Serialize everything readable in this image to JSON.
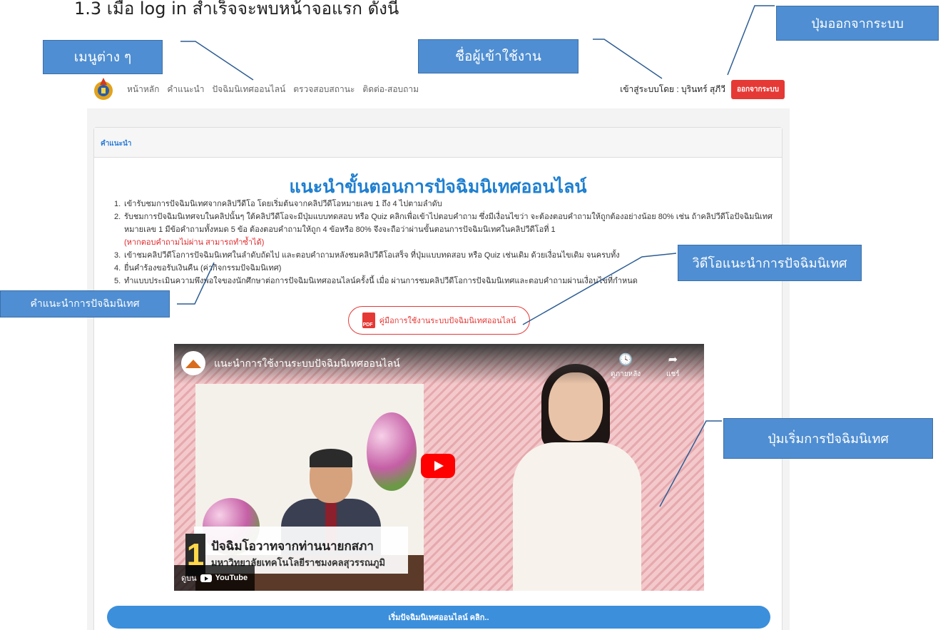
{
  "doc_heading": "1.3 เมื่อ log in สำเร็จจะพบหน้าจอแรก ดังนี้",
  "nav": {
    "menu": [
      "หน้าหลัก",
      "คำแนะนำ",
      "ปัจฉิมนิเทศออนไลน์",
      "ตรวจสอบสถานะ",
      "ติดต่อ-สอบถาม"
    ],
    "login_label": "เข้าสู่ระบบโดย : บุรินทร์ สุภีวี",
    "logout_label": "ออกจากระบบ"
  },
  "card": {
    "header": "คำแนะนำ",
    "title": "แนะนำขั้นตอนการปัจฉิมนิเทศออนไลน์",
    "steps": [
      {
        "num": "1.",
        "text": "เข้ารับชมการปัจฉิมนิเทศจากคลิปวีดีโอ โดยเริ่มต้นจากคลิปวีดีโอหมายเลข 1 ถึง 4 ไปตามลำดับ"
      },
      {
        "num": "2.",
        "text": "รับชมการปัจฉิมนิเทศจบในคลิปนั้นๆ ใต้คลิปวีดีโอจะมีปุ่มแบบทดสอบ หรือ Quiz คลิกเพื่อเข้าไปตอบคำถาม ซึ่งมีเงื่อนไขว่า จะต้องตอบคำถามให้ถูกต้องอย่างน้อย 80% เช่น ถ้าคลิปวีดีโอปัจฉิมนิเทศหมายเลข 1 มีข้อคำถามทั้งหมด 5 ข้อ ต้องตอบคำถามให้ถูก 4 ข้อหรือ 80% จึงจะถือว่าผ่านขั้นตอนการปัจฉิมนิเทศในคลิปวีดีโอที่ 1",
        "note": "(หากตอบคำถามไม่ผ่าน สามารถทำซ้ำได้)"
      },
      {
        "num": "3.",
        "text": "เข้าชมคลิปวีดีโอการปัจฉิมนิเทศในลำดับถัดไป และตอบคำถามหลังชมคลิปวีดีโอเสร็จ ที่ปุ่มแบบทดสอบ หรือ Quiz เช่นเดิม ด้วยเงื่อนไขเดิม จนครบทั้ง"
      },
      {
        "num": "4.",
        "text": "ยื่นคำร้องขอรับเงินคืน (ค่ากิจกรรมปัจฉิมนิเทศ)"
      },
      {
        "num": "5.",
        "text": "ทำแบบประเมินความพึงพอใจของนักศึกษาต่อการปัจฉิมนิเทศออนไลน์ครั้งนี้ เมื่อ ผ่านการชมคลิปวีดีโอการปัจฉิมนิเทศและตอบคำถามผ่านเงื่อนไขที่กำหนด"
      }
    ],
    "manual_label": "คู่มือการใช้งานระบบปัจฉิมนิเทศออนไลน์",
    "start_label": "เริ่มปัจฉิมนิเทศออนไลน์ คลิก.."
  },
  "video": {
    "title": "แนะนำการใช้งานระบบปัจฉิมนิเทศออนไลน์",
    "watch_later": "ดูภายหลัง",
    "share": "แชร์",
    "overlay_number": "1",
    "overlay_line1": "ปัจฉิมโอวาทจากท่านนายกสภา",
    "overlay_line2": "มหาวิทยาลัยเทคโนโลยีราชมงคลสุวรรณภูมิ",
    "watch_on": "ดูบน",
    "youtube": "YouTube"
  },
  "callouts": {
    "menu": "เมนูต่าง ๆ",
    "username": "ชื่อผู้เข้าใช้งาน",
    "logout": "ปุ่มออกจากระบบ",
    "video": "วิดีโอแนะนำการปัจฉิมนิเทศ",
    "instructions": "คำแนะนำการปัจฉิมนิเทศ",
    "start": "ปุ่มเริ่มการปัจฉิมนิเทศ"
  },
  "colors": {
    "accent": "#1e7fd0",
    "logout": "#e53935",
    "callout": "#4f8ed2",
    "start": "#3c8fdb"
  }
}
